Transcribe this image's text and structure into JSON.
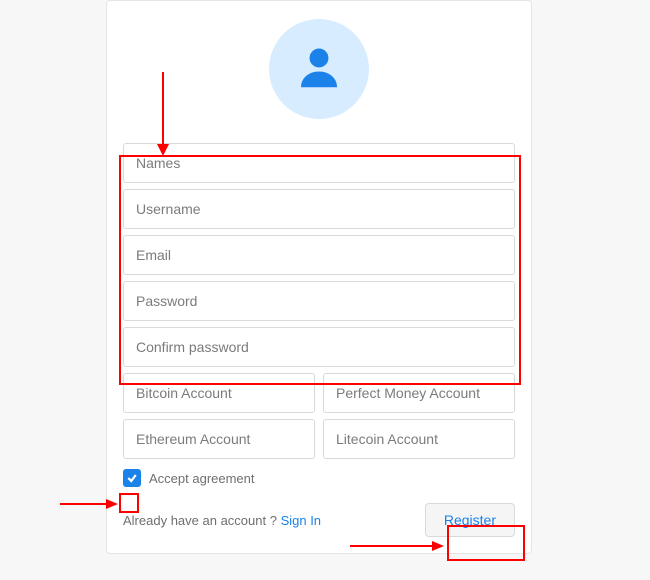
{
  "fields": {
    "names": {
      "placeholder": "Names",
      "value": ""
    },
    "username": {
      "placeholder": "Username",
      "value": ""
    },
    "email": {
      "placeholder": "Email",
      "value": ""
    },
    "password": {
      "placeholder": "Password",
      "value": ""
    },
    "confirm_password": {
      "placeholder": "Confirm password",
      "value": ""
    },
    "bitcoin": {
      "placeholder": "Bitcoin Account",
      "value": ""
    },
    "perfect_money": {
      "placeholder": "Perfect Money Account",
      "value": ""
    },
    "ethereum": {
      "placeholder": "Ethereum Account",
      "value": ""
    },
    "litecoin": {
      "placeholder": "Litecoin Account",
      "value": ""
    }
  },
  "agreement": {
    "label": "Accept agreement",
    "checked": true
  },
  "footer": {
    "have_account_text": "Already have an account ? ",
    "signin_label": "Sign In",
    "register_label": "Register"
  },
  "colors": {
    "accent": "#1a82e8",
    "avatar_bg": "#d8ecff",
    "annotation": "#ff0000"
  }
}
